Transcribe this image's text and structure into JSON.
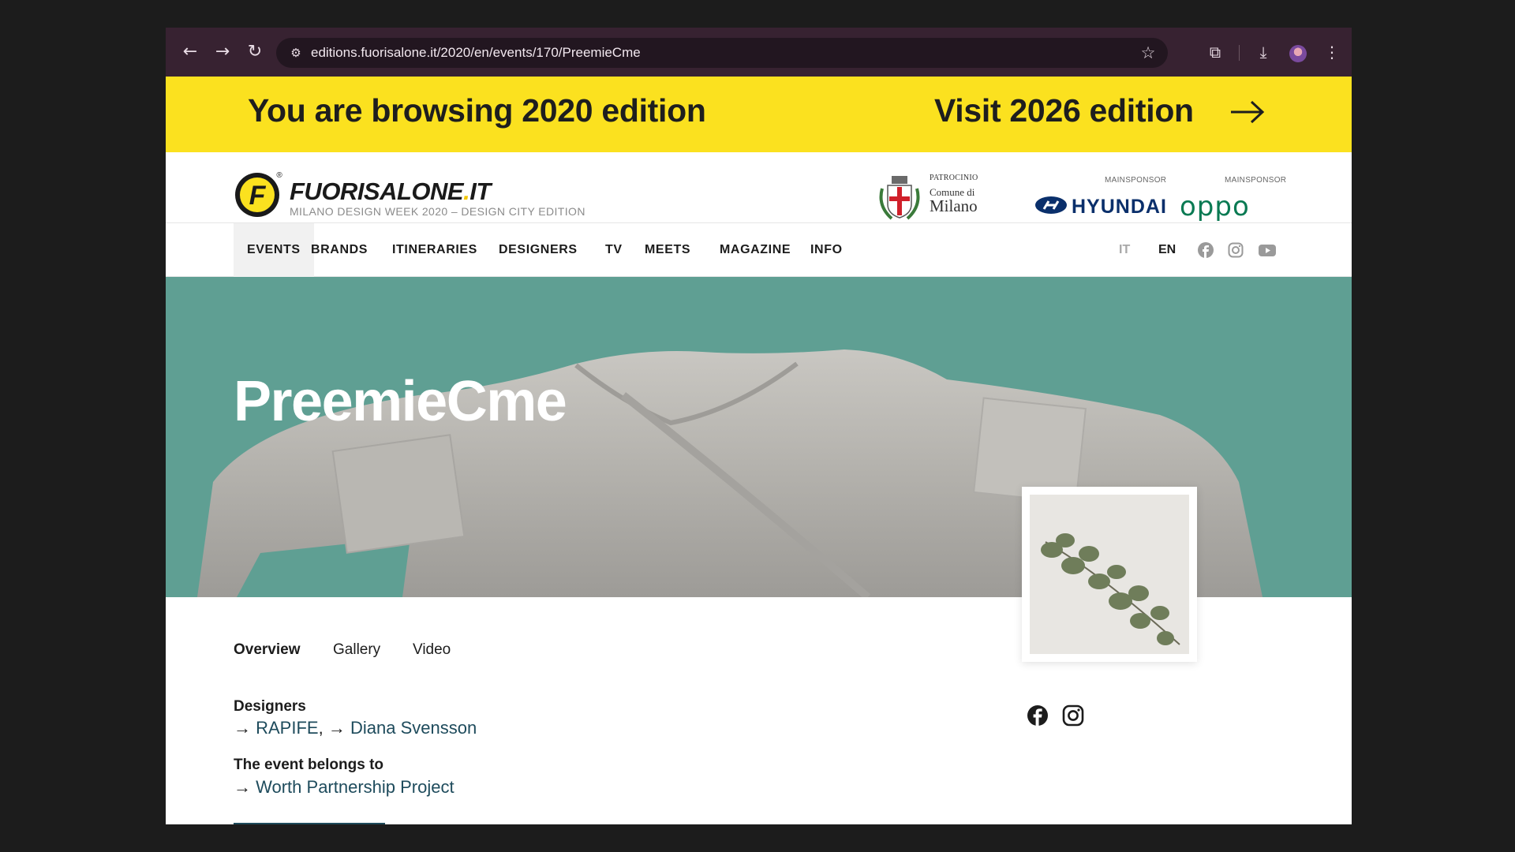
{
  "browser": {
    "url": "editions.fuorisalone.it/2020/en/events/170/PreemieCme",
    "icons": [
      "back-arrow-icon",
      "forward-arrow-icon",
      "reload-icon",
      "site-settings-icon",
      "bookmark-star-icon",
      "extensions-icon",
      "download-icon",
      "profile-avatar",
      "menu-dots-icon"
    ]
  },
  "banner": {
    "left_text": "You are browsing 2020 edition",
    "right_text": "Visit 2026 edition",
    "color": "#fbe11f"
  },
  "header": {
    "logo_text": "FUORISALONE",
    "logo_dot": ".",
    "logo_tld": "IT",
    "logo_registered": "®",
    "logo_letter": "F",
    "subtitle": "MILANO DESIGN WEEK 2020 – DESIGN CITY EDITION",
    "patrocinio": "PATROCINIO",
    "comune": "Comune di",
    "milano": "Milano",
    "mainsponsor_1": "MAINSPONSOR",
    "mainsponsor_2": "MAINSPONSOR",
    "hyundai": "HYUNDAI",
    "oppo": "oppo"
  },
  "nav": {
    "items": [
      "EVENTS",
      "BRANDS",
      "ITINERARIES",
      "DESIGNERS",
      "TV",
      "MEETS",
      "MAGAZINE",
      "INFO"
    ],
    "active": "EVENTS",
    "lang_it": "IT",
    "lang_en": "EN",
    "social": [
      "facebook-icon",
      "instagram-icon",
      "youtube-icon"
    ]
  },
  "hero": {
    "title": "PreemieCme",
    "bg_color": "#5f9f93"
  },
  "content": {
    "tabs": [
      "Overview",
      "Gallery",
      "Video"
    ],
    "active_tab": "Overview",
    "designers_label": "Designers",
    "designers": [
      "RAPIFE",
      "Diana Svensson"
    ],
    "belongs_label": "The event belongs to",
    "belongs_to": "Worth Partnership Project",
    "arrow": "→",
    "comma": ","
  }
}
